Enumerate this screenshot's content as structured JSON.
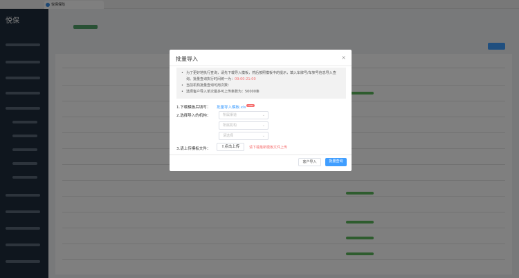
{
  "browser": {
    "tab_title": "悦保保险"
  },
  "sidebar": {
    "logo": "悦保"
  },
  "modal": {
    "title": "批量导入",
    "close": "×",
    "info": {
      "line1_prefix": "为了更好地执行查询，请先下载导入模板，然后按照模板中的提示，填入车牌号/车架号信息导入查询。批量查询执行时间统一为：",
      "line1_time": "09:00-21:00",
      "line2": "当前机构批量查询可用次数：",
      "line3": "选择客户导入单次最多可上传条数为：50000条"
    },
    "step1_label": "1.下载模板后填写：",
    "template_link": "批量导入模板.xls",
    "new_badge": "new",
    "step2_label": "2.选择导入的机构：",
    "selects": [
      {
        "placeholder": "所属渠道"
      },
      {
        "placeholder": "所属机构"
      },
      {
        "placeholder": "请选择"
      }
    ],
    "step3_label": "3.请上传模板文件：",
    "upload_button": "⇧点击上传",
    "upload_hint": "请下载最新模板文件上传",
    "customer_import_button": "客户导入",
    "batch_query_button": "批量查询"
  }
}
